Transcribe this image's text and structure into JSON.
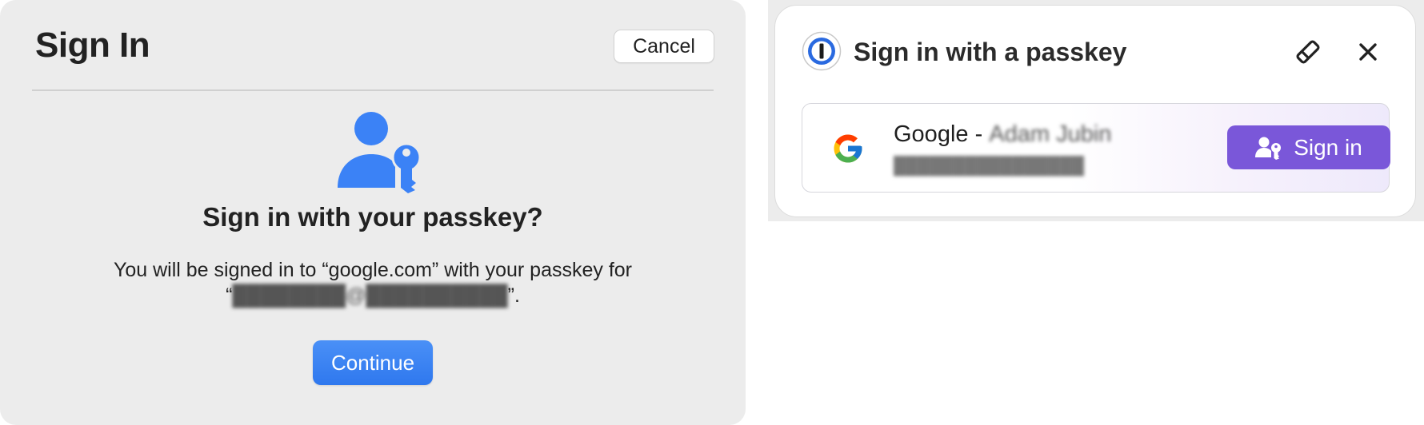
{
  "mac_dialog": {
    "title": "Sign In",
    "cancel_label": "Cancel",
    "icon": "person-key-icon",
    "heading": "Sign in with your passkey?",
    "body_line1": "You will be signed in to “google.com” with your passkey for",
    "body_quote_open": "“",
    "account_redacted": "████████@██████████",
    "body_quote_close": "”.",
    "continue_label": "Continue",
    "accent_color": "#3b82f6"
  },
  "onepassword_popup": {
    "title": "Sign in with a passkey",
    "logo_icon": "1password-logo-icon",
    "edit_icon": "pencil-icon",
    "close_icon": "close-icon",
    "item": {
      "icon": "google-g-icon",
      "title_prefix": "Google - ",
      "title_redacted": "Adam Jubin",
      "subtitle_redacted": "████████████████",
      "signin_label": "Sign in",
      "signin_icon": "passkey-person-icon"
    },
    "accent_color": "#7a57d9"
  }
}
